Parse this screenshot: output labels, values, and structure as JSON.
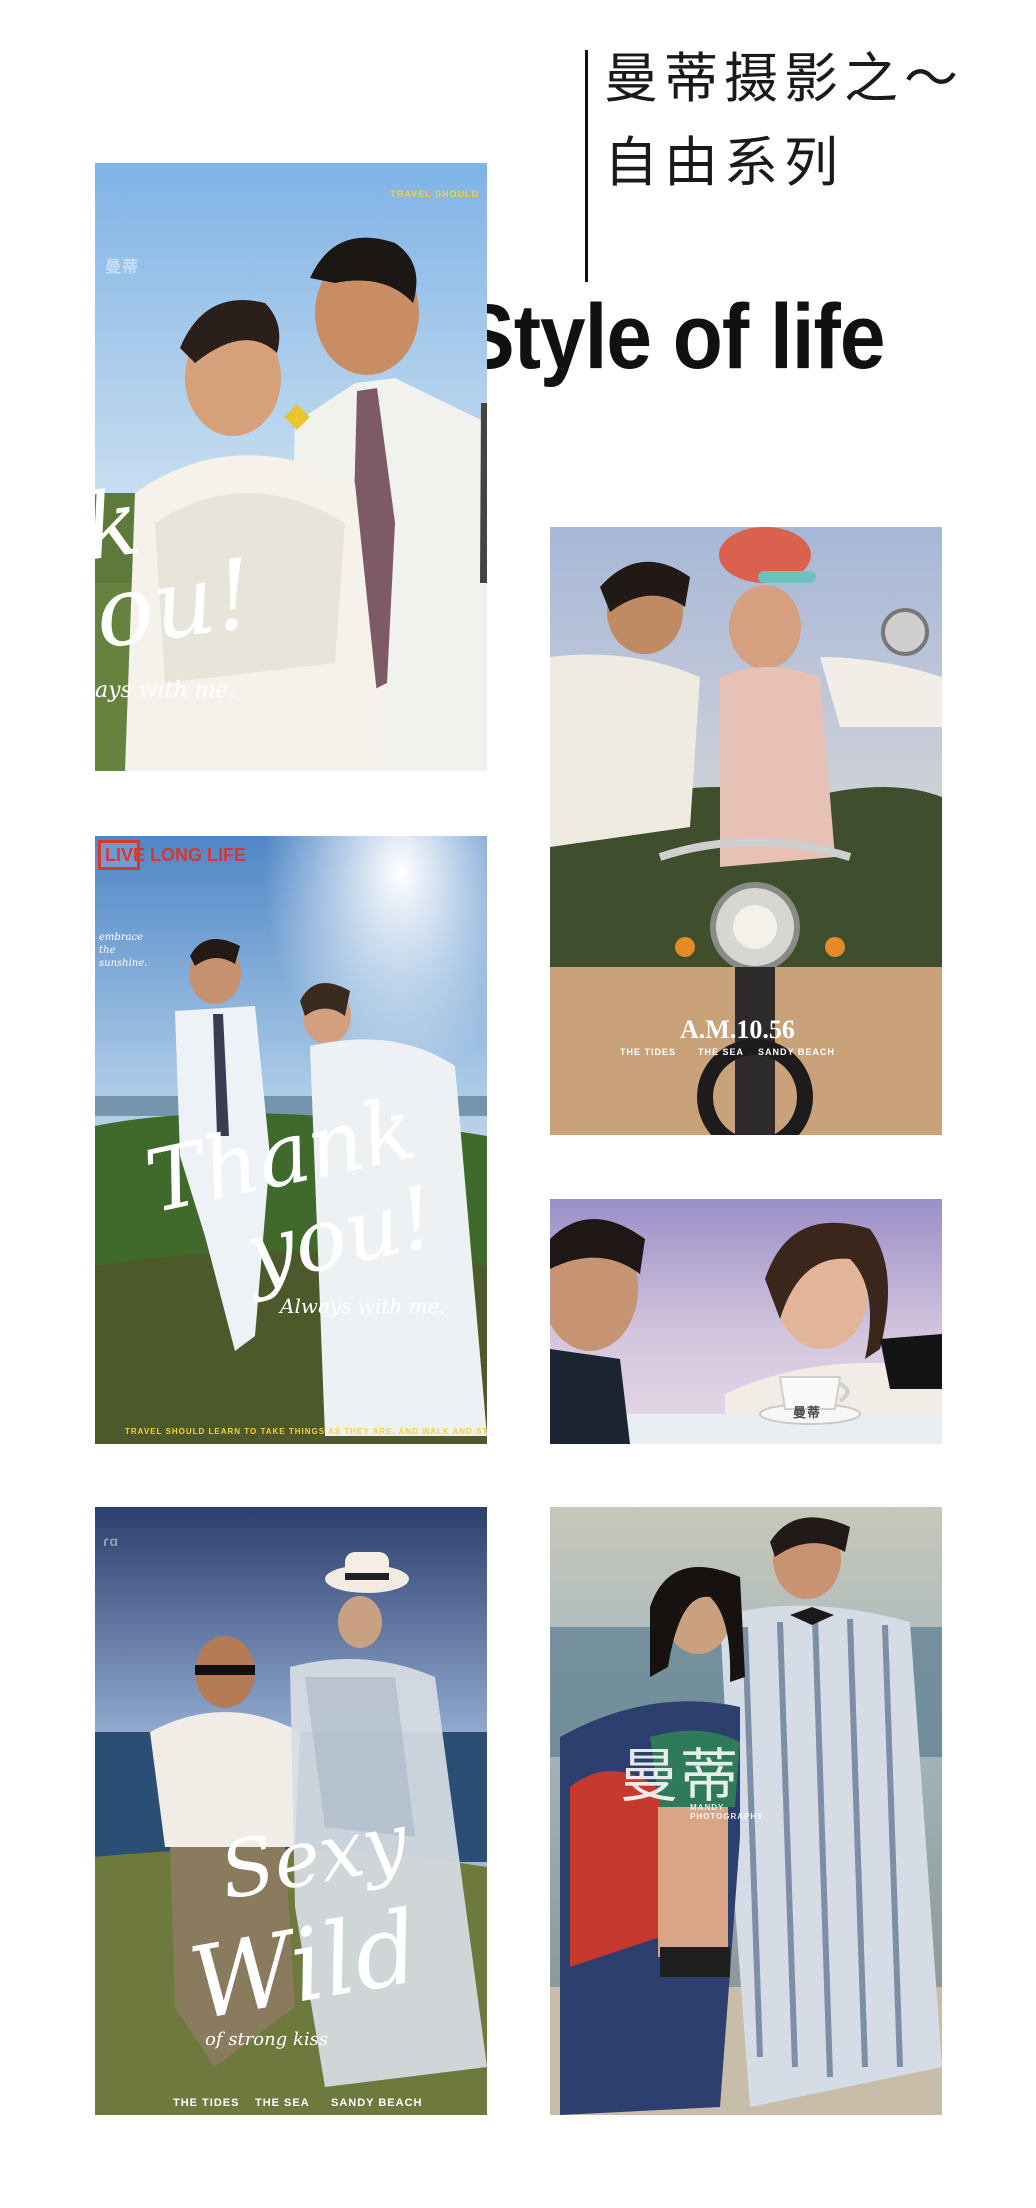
{
  "header": {
    "title_line1": "曼蒂摄影之～",
    "title_line2": "自由系列",
    "headline": "Style of life"
  },
  "photos": [
    {
      "overlay_top": "TRAVEL SHOULD",
      "script": "k",
      "script2": "ou!",
      "tagline": "ays with me.",
      "watermark": "曼蒂"
    },
    {
      "badge": "LIVE LONG LIFE",
      "badge_note": "embrace the sunshine.",
      "script": "Thank",
      "script2": "you!",
      "tagline": "Always with me.",
      "footer": "TRAVEL SHOULD LEARN TO TAKE THINGS AS THEY ARE, AND WALK AND STOP."
    },
    {
      "script": "Sexy",
      "script2": "Wild",
      "tagline": "of strong kiss",
      "footer": [
        "THE TIDES",
        "THE SEA",
        "SANDY BEACH"
      ]
    },
    {
      "time": "A.M.10.56",
      "footer": [
        "THE TIDES",
        "THE SEA",
        "SANDY BEACH"
      ]
    },
    {
      "watermark": "曼蒂"
    },
    {
      "logo": "曼蒂",
      "logo_sub": "MANDY PHOTOGRAPHY"
    }
  ],
  "colors": {
    "text": "#111111",
    "badge_red": "#d8382b",
    "accent_yellow": "#f2d23a"
  }
}
